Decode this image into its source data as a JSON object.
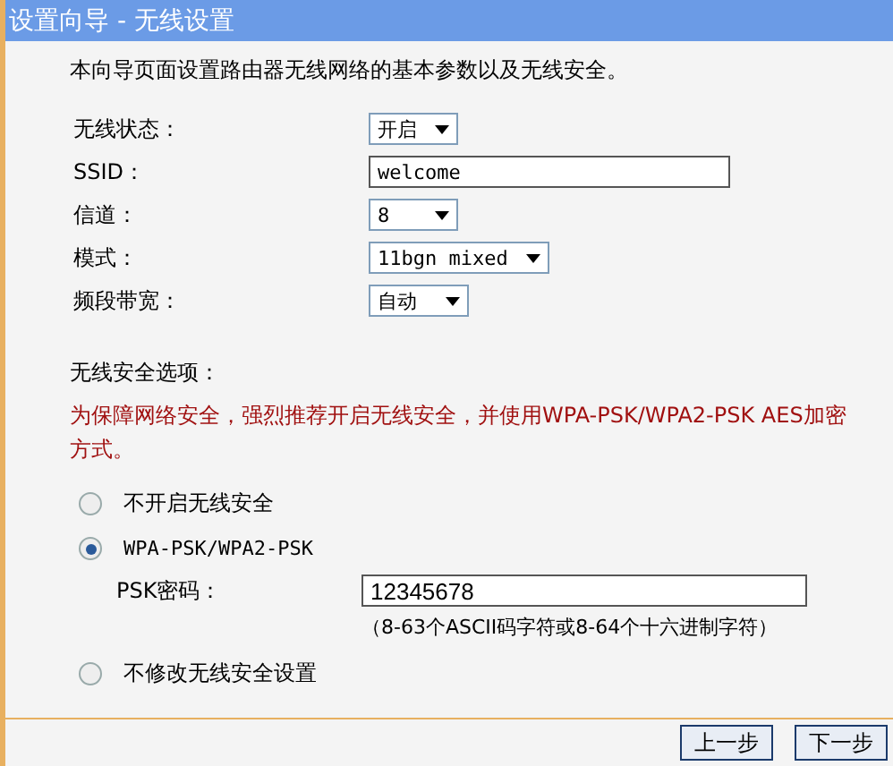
{
  "window": {
    "title": "设置向导 - 无线设置"
  },
  "intro": "本向导页面设置路由器无线网络的基本参数以及无线安全。",
  "fields": [
    {
      "kind": "select",
      "label": "无线状态：",
      "value": "开启"
    },
    {
      "kind": "text",
      "label": "SSID：",
      "value": "welcome"
    },
    {
      "kind": "select",
      "label": "信道：",
      "value": "8"
    },
    {
      "kind": "select",
      "label": "模式：",
      "value": "11bgn mixed"
    },
    {
      "kind": "select",
      "label": "频段带宽：",
      "value": "自动"
    }
  ],
  "security": {
    "heading": "无线安全选项：",
    "warning": "为保障网络安全，强烈推荐开启无线安全，并使用WPA-PSK/WPA2-PSK AES加密方式。",
    "options": [
      {
        "label": "不开启无线安全",
        "selected": false
      },
      {
        "label": "WPA-PSK/WPA2-PSK",
        "selected": true,
        "password": {
          "label": "PSK密码：",
          "value": "12345678",
          "hint": "（8-63个ASCII码字符或8-64个十六进制字符）"
        }
      },
      {
        "label": "不修改无线安全设置",
        "selected": false
      }
    ]
  },
  "buttons": [
    "上一步",
    "下一步"
  ]
}
